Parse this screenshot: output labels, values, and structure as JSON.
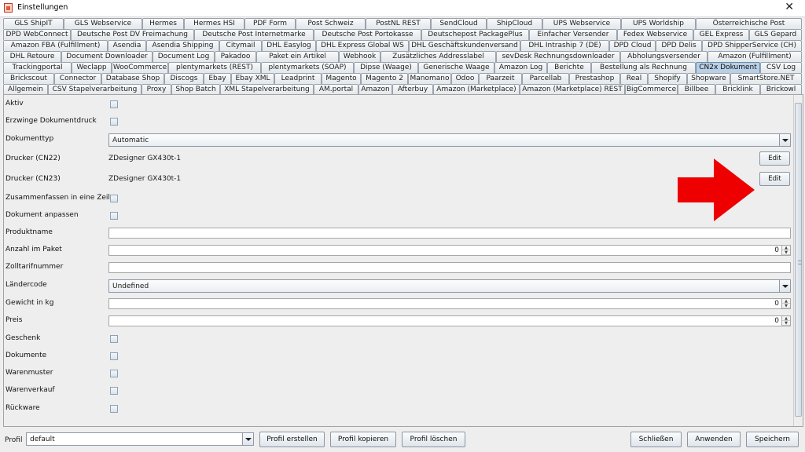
{
  "window": {
    "title": "Einstellungen",
    "close_glyph": "✕"
  },
  "tab_rows": [
    [
      "GLS ShipIT",
      "GLS Webservice",
      "Hermes",
      "Hermes HSI",
      "PDF Form",
      "Post Schweiz",
      "PostNL REST",
      "SendCloud",
      "ShipCloud",
      "UPS Webservice",
      "UPS Worldship",
      "Österreichische Post"
    ],
    [
      "DPD WebConnect",
      "Deutsche Post DV Freimachung",
      "Deutsche Post Internetmarke",
      "Deutsche Post Portokasse",
      "Deutschepost PackagePlus",
      "Einfacher Versender",
      "Fedex Webservice",
      "GEL Express",
      "GLS Gepard"
    ],
    [
      "Amazon FBA (Fulfillment)",
      "Asendia",
      "Asendia Shipping",
      "Citymail",
      "DHL Easylog",
      "DHL Express Global WS",
      "DHL Geschäftskundenversand",
      "DHL Intraship 7 (DE)",
      "DPD Cloud",
      "DPD Delis",
      "DPD ShipperService (CH)"
    ],
    [
      "DHL Retoure",
      "Document Downloader",
      "Document Log",
      "Pakadoo",
      "Paket ein Artikel",
      "Webhook",
      "Zusätzliches Addresslabel",
      "sevDesk Rechnungsdownloader",
      "Abholungsversender",
      "Amazon (Fulfillment)"
    ],
    [
      "Trackingportal",
      "Weclapp",
      "WooCommerce",
      "plentymarkets (REST)",
      "plentymarkets (SOAP)",
      "Dipse (Waage)",
      "Generische Waage",
      "Amazon Log",
      "Berichte",
      "Bestellung als Rechnung",
      "CN2x Dokument",
      "CSV Log"
    ],
    [
      "Brickscout",
      "Connector",
      "Database Shop",
      "Discogs",
      "Ebay",
      "Ebay XML",
      "Leadprint",
      "Magento",
      "Magento 2",
      "Manomano",
      "Odoo",
      "Paarzeit",
      "Parcellab",
      "Prestashop",
      "Real",
      "Shopify",
      "Shopware",
      "SmartStore.NET"
    ],
    [
      "Allgemein",
      "CSV Stapelverarbeitung",
      "Proxy",
      "Shop Batch",
      "XML Stapelverarbeitung",
      "AM.portal",
      "Amazon",
      "Afterbuy",
      "Amazon (Marketplace)",
      "Amazon (Marketplace) REST",
      "BigCommerce",
      "Billbee",
      "Bricklink",
      "Brickowl"
    ]
  ],
  "selected_tab": "CN2x Dokument",
  "form": {
    "aktiv": "Aktiv",
    "erzwinge": "Erzwinge Dokumentdruck",
    "dokumenttyp": "Dokumenttyp",
    "dokumenttyp_value": "Automatic",
    "drucker_cn22": "Drucker (CN22)",
    "drucker_cn22_value": "ZDesigner GX430t-1",
    "drucker_cn23": "Drucker (CN23)",
    "drucker_cn23_value": "ZDesigner GX430t-1",
    "edit_label": "Edit",
    "zusammenfassen": "Zusammenfassen in eine Zeile",
    "anpassen": "Dokument anpassen",
    "produktname": "Produktname",
    "anzahl": "Anzahl im Paket",
    "anzahl_value": "0",
    "zolltarif": "Zolltarifnummer",
    "laendercode": "Ländercode",
    "laendercode_value": "Undefined",
    "gewicht": "Gewicht in kg",
    "gewicht_value": "0",
    "preis": "Preis",
    "preis_value": "0",
    "geschenk": "Geschenk",
    "dokumente": "Dokumente",
    "warenmuster": "Warenmuster",
    "warenverkauf": "Warenverkauf",
    "rueckware": "Rückware"
  },
  "footer": {
    "profil_label": "Profil",
    "profil_value": "default",
    "profil_erstellen": "Profil erstellen",
    "profil_kopieren": "Profil kopieren",
    "profil_loeschen": "Profil löschen",
    "schliessen": "Schließen",
    "anwenden": "Anwenden",
    "speichern": "Speichern"
  },
  "colors": {
    "annotation_arrow": "#ee0000",
    "selected_tab": "#b8cfe5"
  }
}
